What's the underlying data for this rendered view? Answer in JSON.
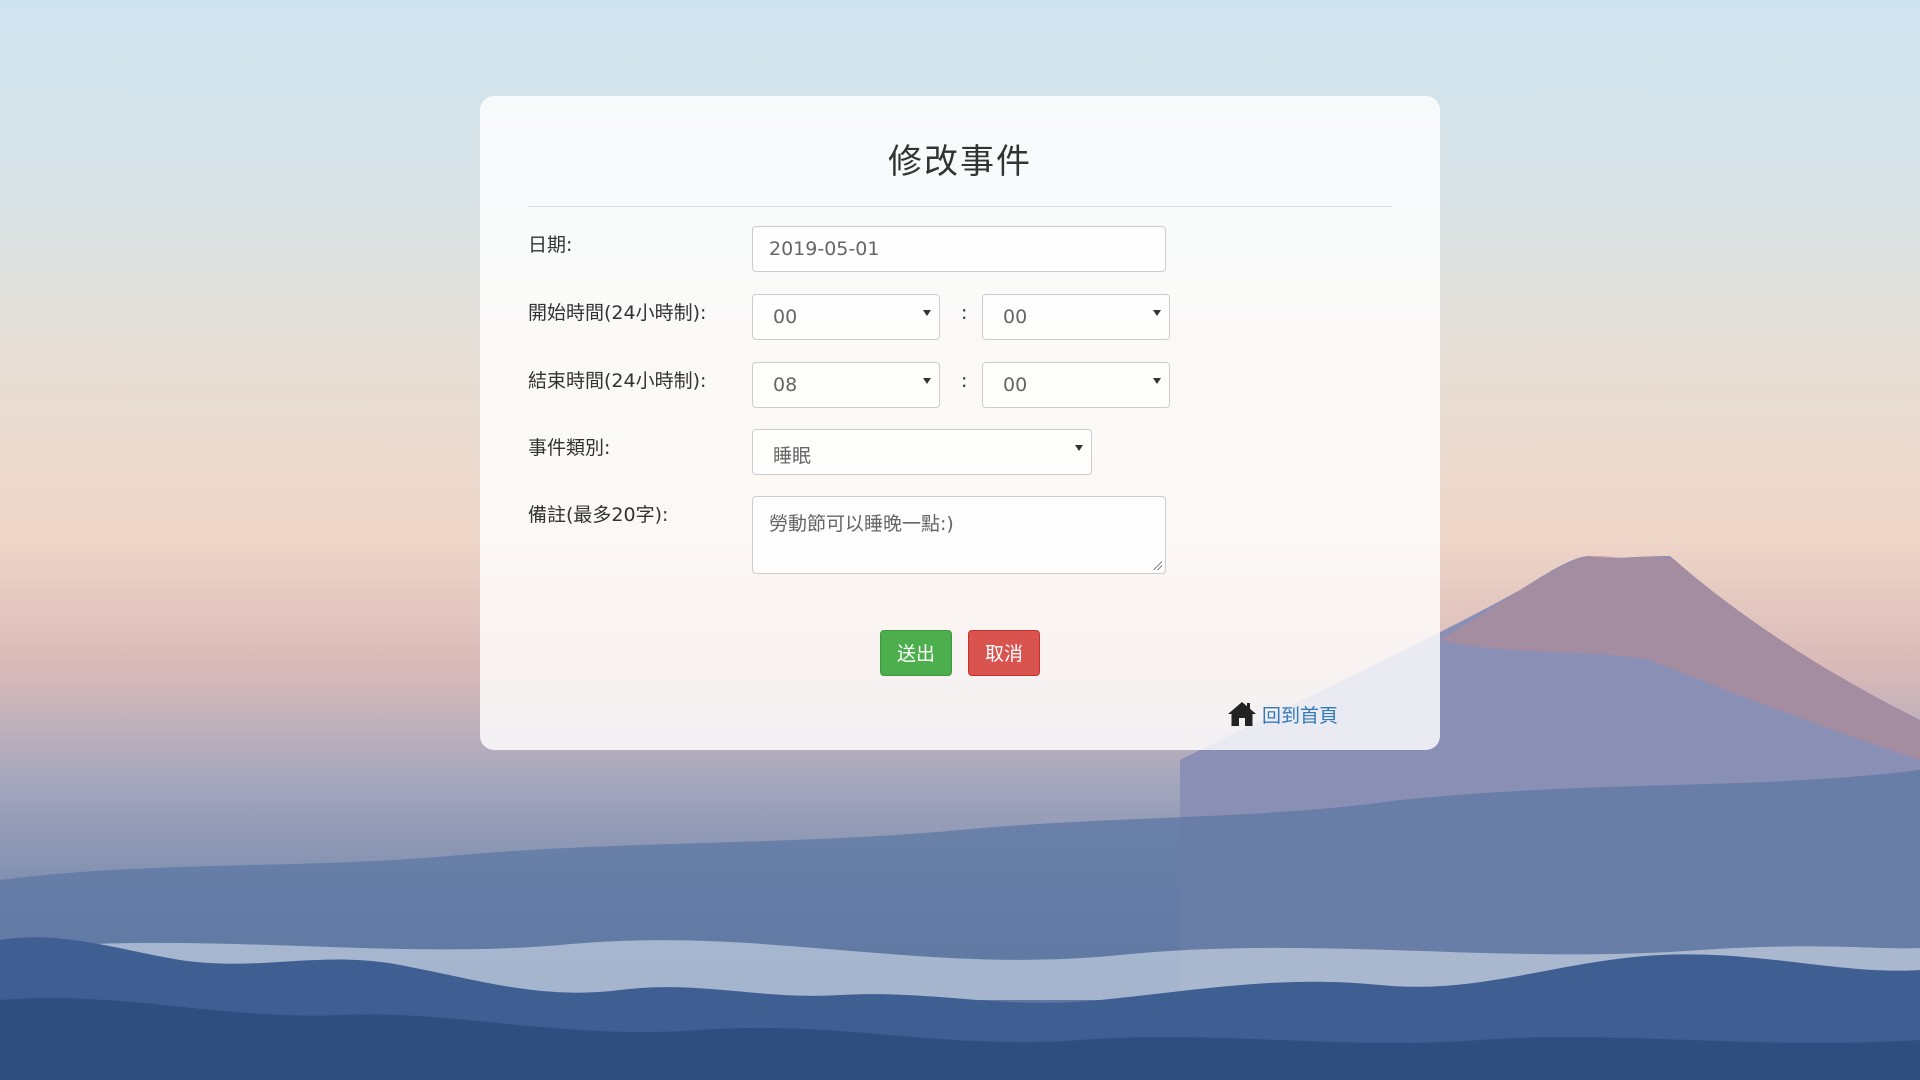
{
  "form": {
    "title": "修改事件",
    "date": {
      "label": "日期:",
      "value": "2019-05-01"
    },
    "start_time": {
      "label": "開始時間(24小時制):",
      "hour": "00",
      "separator": ":",
      "minute": "00"
    },
    "end_time": {
      "label": "結束時間(24小時制):",
      "hour": "08",
      "separator": ":",
      "minute": "00"
    },
    "category": {
      "label": "事件類別:",
      "value": "睡眠"
    },
    "note": {
      "label": "備註(最多20字):",
      "value": "勞動節可以睡晚一點:)"
    },
    "buttons": {
      "submit": "送出",
      "cancel": "取消"
    },
    "home_link": {
      "icon": "home-icon",
      "label": "回到首頁"
    }
  },
  "colors": {
    "submit": "#4cae4c",
    "cancel": "#d9534f",
    "link": "#337ab7"
  }
}
